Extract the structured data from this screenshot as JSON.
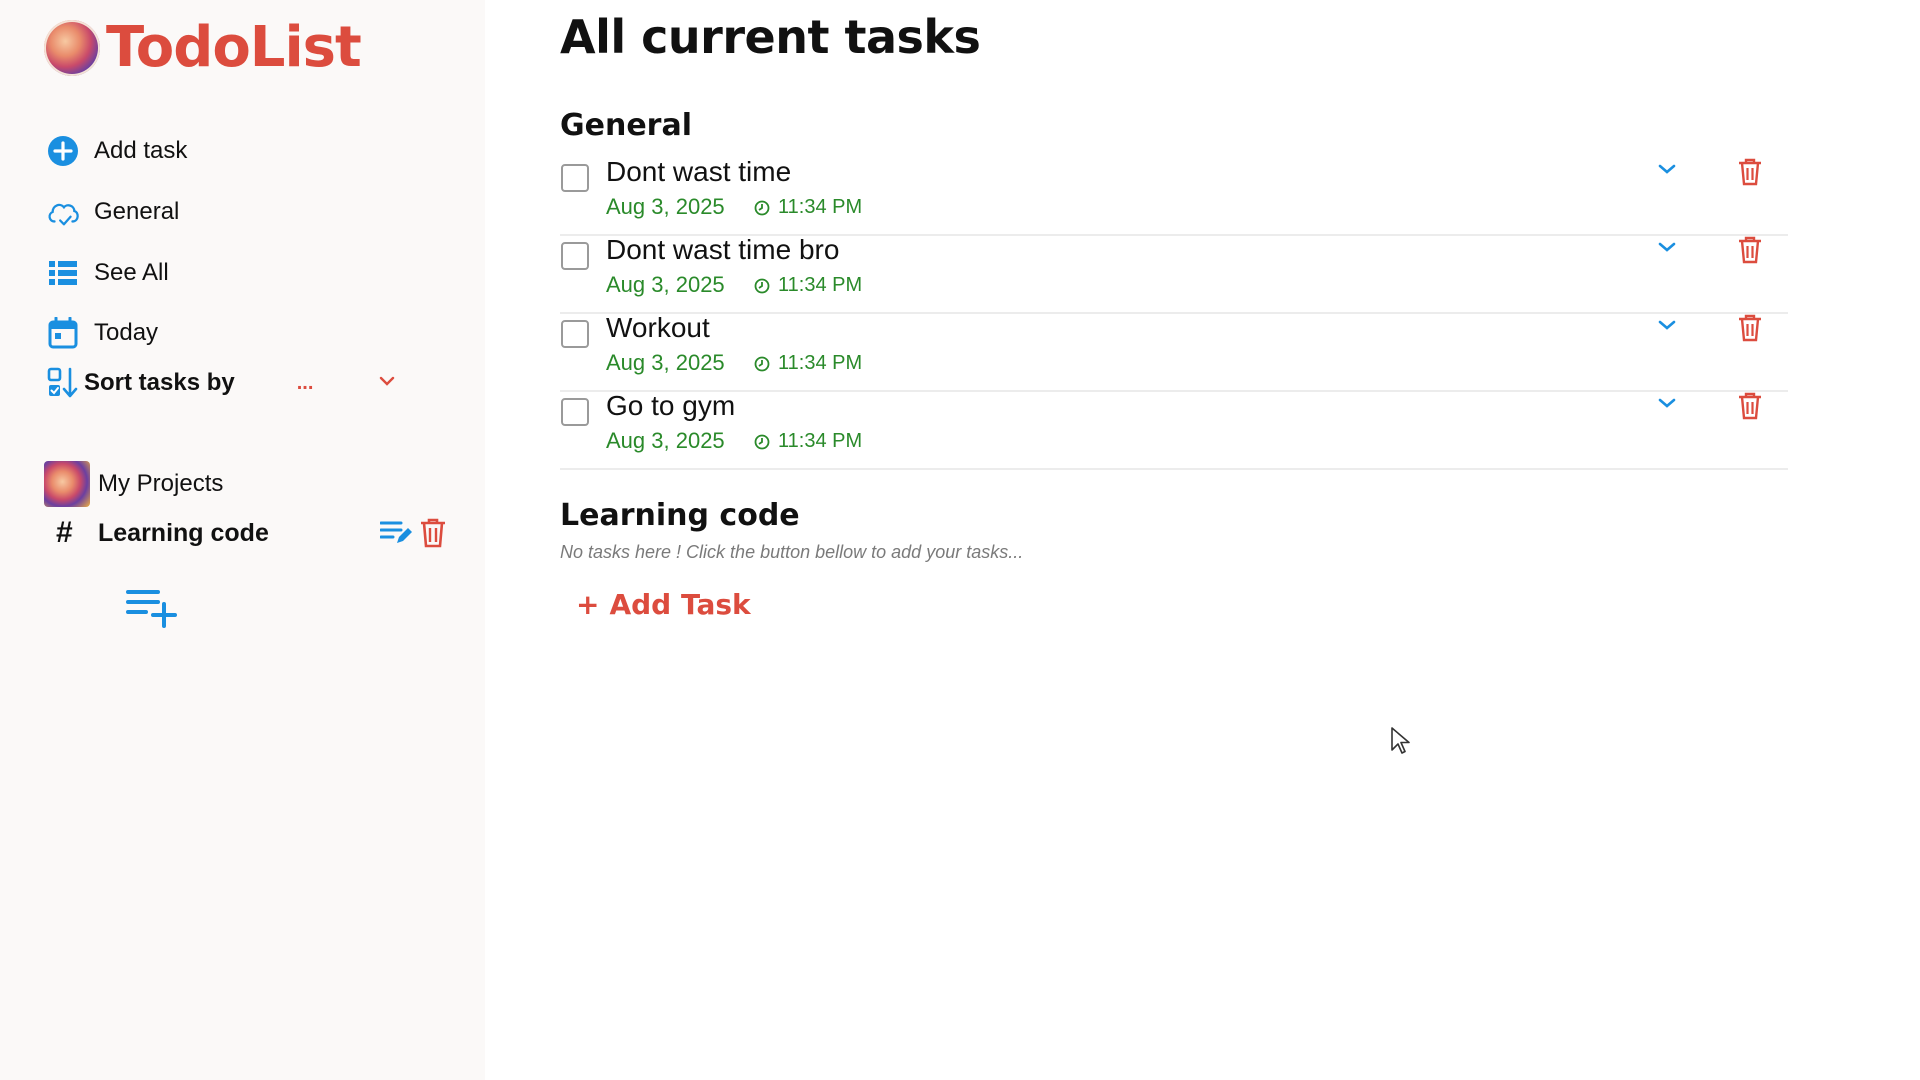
{
  "app": {
    "title": "TodoList"
  },
  "sidebar": {
    "items": [
      {
        "label": "Add task",
        "icon": "plus-circle-icon"
      },
      {
        "label": "General",
        "icon": "cloud-check-icon"
      },
      {
        "label": "See All",
        "icon": "list-icon"
      },
      {
        "label": "Today",
        "icon": "calendar-icon"
      }
    ],
    "sort": {
      "label": "Sort tasks by",
      "value": "...",
      "icon": "sort-icon"
    },
    "projects": {
      "heading": "My Projects",
      "items": [
        {
          "label": "Learning code",
          "prefix": "#"
        }
      ]
    }
  },
  "main": {
    "title": "All current tasks",
    "sections": [
      {
        "title": "General",
        "tasks": [
          {
            "title": "Dont wast time",
            "date": "Aug 3, 2025",
            "time": "11:34 PM"
          },
          {
            "title": "Dont wast time bro",
            "date": "Aug 3, 2025",
            "time": "11:34 PM"
          },
          {
            "title": "Workout",
            "date": "Aug 3, 2025",
            "time": "11:34 PM"
          },
          {
            "title": "Go to gym",
            "date": "Aug 3, 2025",
            "time": "11:34 PM"
          }
        ]
      },
      {
        "title": "Learning code",
        "empty_message": "No tasks here ! Click the button bellow to add your tasks...",
        "add_button": {
          "plus": "+",
          "label": "Add Task"
        }
      }
    ]
  },
  "colors": {
    "brand": "#dc4c3e",
    "accent": "#1a8fe0",
    "date_green": "#2a8a2a",
    "sidebar_bg": "#fbf9f8"
  }
}
